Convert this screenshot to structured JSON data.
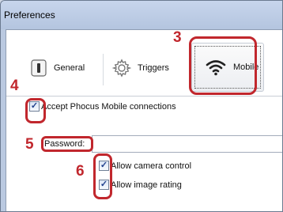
{
  "window": {
    "title": "Preferences"
  },
  "toolbar": {
    "tabs": [
      {
        "label": "General",
        "icon": "switch-icon"
      },
      {
        "label": "Triggers",
        "icon": "gear-icon"
      },
      {
        "label": "Mobile",
        "icon": "wifi-icon",
        "selected": true
      }
    ]
  },
  "mobile": {
    "accept_connections": {
      "label": "Accept Phocus Mobile connections",
      "checked": true
    },
    "password": {
      "label": "Password:",
      "value": ""
    },
    "allow_camera_control": {
      "label": "Allow camera control",
      "checked": true
    },
    "allow_image_rating": {
      "label": "Allow image rating",
      "checked": true
    }
  },
  "annotations": {
    "marker_3": "3",
    "marker_4": "4",
    "marker_5": "5",
    "marker_6": "6",
    "color": "#c1272d"
  }
}
